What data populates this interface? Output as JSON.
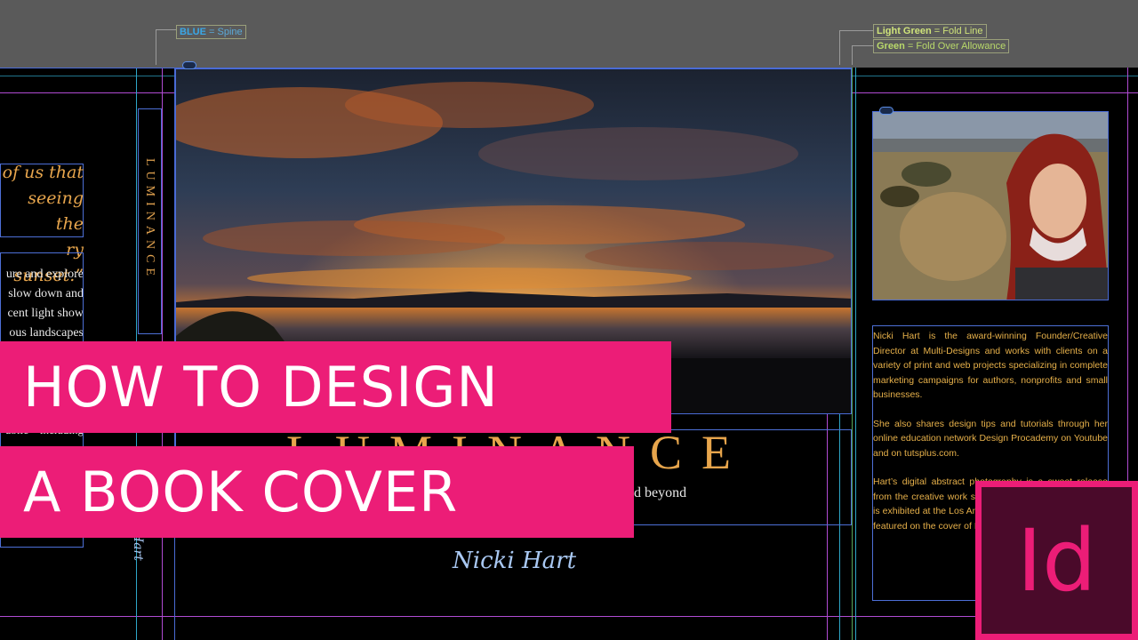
{
  "pasteboard": {
    "spine_legend": {
      "key": "BLUE",
      "rest": " = Spine"
    },
    "fold_legend": {
      "key": "Light Green",
      "rest": " = Fold Line"
    },
    "allowance_legend": {
      "key": "Green",
      "rest": " = Fold Over Allowance"
    }
  },
  "back_flap": {
    "quote_lines": [
      "of us that",
      "seeing the",
      "ry sunset.”"
    ],
    "body_lines": [
      "ure and explore",
      "slow down and",
      "cent light show",
      "ous  landscapes",
      "ublic—including"
    ]
  },
  "spine": {
    "title": "LUMINANCE",
    "author": "Hart"
  },
  "front_cover": {
    "title": "LUMINANCE",
    "subtitle": "d beyond",
    "author_signature": "Nicki Hart"
  },
  "author_flap": {
    "bio_paragraphs": [
      "Nicki Hart is the award-winning Founder/Creative Director at Multi-Designs and works with clients on a variety of print and web projects specializing in complete marketing campaigns for authors, nonprofits and small businesses.",
      "She also shares design tips and tutorials through her online education network Design Procademy on Youtube and on tutsplus.com.",
      "Hart’s digital abstract photography is a sweet release from the creative work she creates every day. Her work is exhibited at the Los Angeles Center for Digital Art, and featured on the cover of Magazine’s 50th issue."
    ]
  },
  "overlay": {
    "banner_line1": "HOW TO DESIGN",
    "banner_line2": "A BOOK COVER",
    "app_logo": "Id"
  },
  "colors": {
    "banner": "#ec1d77",
    "title_gold": "#e7a54c",
    "guide_purple": "#b04bd3",
    "guide_cyan": "#2ea7c8",
    "frame_blue": "#4a6bd6"
  }
}
